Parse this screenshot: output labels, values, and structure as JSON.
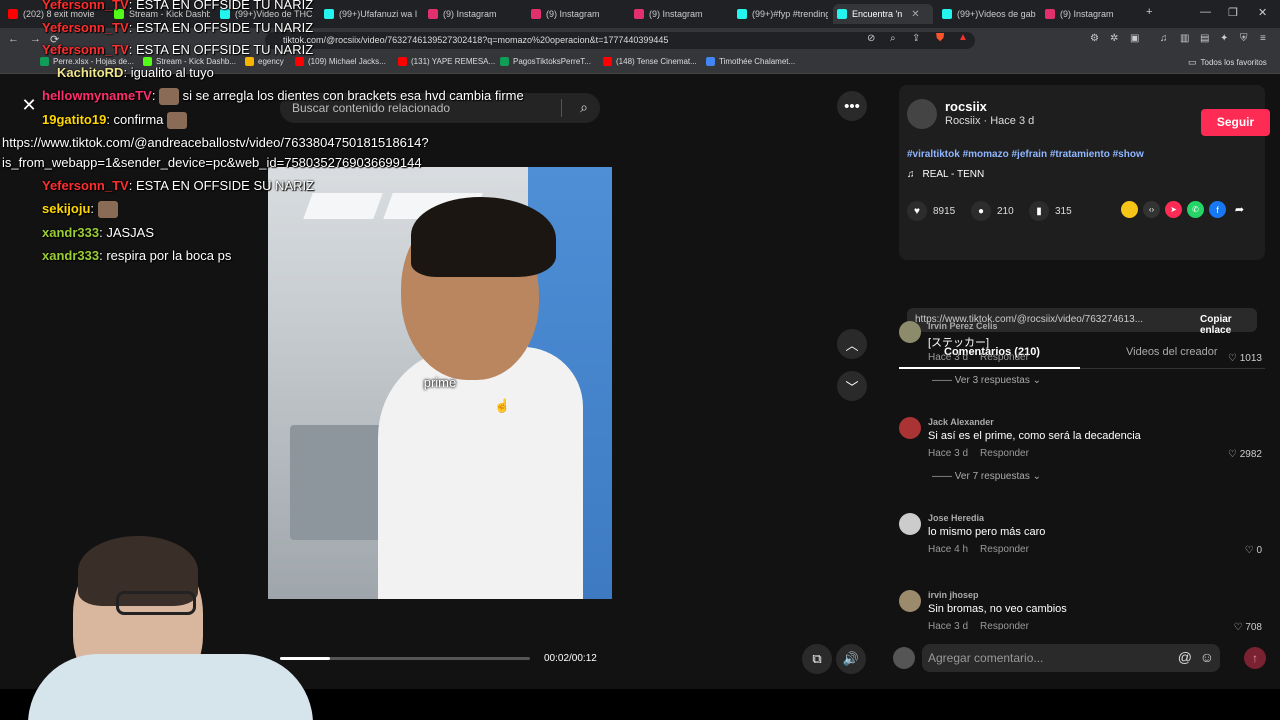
{
  "browser": {
    "tabs": [
      {
        "label": "(202) 8 exit movie",
        "color": "#ff0000"
      },
      {
        "label": "Stream - Kick Dashb",
        "color": "#53fc18"
      },
      {
        "label": "(99+)Video de THC",
        "color": "#25f4ee"
      },
      {
        "label": "(99+)Ufafanuzi wa I",
        "color": "#25f4ee"
      },
      {
        "label": "(9) Instagram",
        "color": "#e1306c"
      },
      {
        "label": "(9) Instagram",
        "color": "#e1306c"
      },
      {
        "label": "(9) Instagram",
        "color": "#e1306c"
      },
      {
        "label": "(99+)#fyp #trending",
        "color": "#25f4ee"
      },
      {
        "label": "Encuentra 'n",
        "color": "#25f4ee"
      },
      {
        "label": "(99+)Videos de gab",
        "color": "#25f4ee"
      },
      {
        "label": "(9) Instagram",
        "color": "#e1306c"
      }
    ],
    "url": "tiktok.com/@rocsiix/video/7632746139527302418?q=momazo%20operacion&t=1777440399445",
    "bookmarks": [
      {
        "label": "Perre.xlsx - Hojas de...",
        "color": "#0f9d58"
      },
      {
        "label": "Stream - Kick Dashb...",
        "color": "#53fc18"
      },
      {
        "label": "egency",
        "color": "#f4b400"
      },
      {
        "label": "(109) Michael Jacks...",
        "color": "#ff0000"
      },
      {
        "label": "(131) YAPE REMESA...",
        "color": "#ff0000"
      },
      {
        "label": "PagosTiktoksPerreT...",
        "color": "#0f9d58"
      },
      {
        "label": "(148) Tense Cinemat...",
        "color": "#ff0000"
      },
      {
        "label": "Timothée Chalamet...",
        "color": "#4285f4"
      }
    ],
    "all_bookmarks": "Todos los favoritos"
  },
  "chat": [
    {
      "user": "Yefersonn_TV",
      "color": "#ff2e2e",
      "msg": "ESTA EN OFFSIDE TU NARIZ"
    },
    {
      "user": "Yefersonn_TV",
      "color": "#ff2e2e",
      "msg": "ESTA EN OFFSIDE TU NARIZ"
    },
    {
      "user": "Yefersonn_TV",
      "color": "#ff2e2e",
      "msg": "ESTA EN OFFSIDE TU NARIZ"
    },
    {
      "user": "KachitoRD",
      "color": "#f0e68c",
      "msg": "igualito al tuyo"
    },
    {
      "user": "hellowmynameTV",
      "color": "#ff2e6e",
      "msg": "si se arregla los dientes con brackets esa hvd cambia firme"
    },
    {
      "user": "19gatito19",
      "color": "#ffd700",
      "msg": "confirma"
    },
    {
      "link1": "https://www.tiktok.com/@andreaceballostv/video/7633804750181518614?",
      "link2": "is_from_webapp=1&sender_device=pc&web_id=7580352769036699144"
    },
    {
      "user": "Yefersonn_TV",
      "color": "#ff2e2e",
      "msg": "ESTA EN OFFSIDE SU NARIZ"
    },
    {
      "user": "sekijoju",
      "color": "#ffd700",
      "msg": ""
    },
    {
      "user": "xandr333",
      "color": "#9acd32",
      "msg": "JASJAS"
    },
    {
      "user": "xandr333",
      "color": "#9acd32",
      "msg": "respira por la boca ps"
    }
  ],
  "video": {
    "search_placeholder": "Buscar contenido relacionado",
    "caption": "prime",
    "time": "00:02/00:12",
    "progress": 0.2
  },
  "creator": {
    "handle": "rocsiix",
    "subline": "Rocsiix · Hace 3 d",
    "follow": "Seguir",
    "hashtags": "#viraltiktok #momazo #jefrain #tratamiento #show",
    "music": "REAL - TENN",
    "likes": "8915",
    "comments": "210",
    "saves": "315",
    "link": "https://www.tiktok.com/@rocsiix/video/763274613...",
    "copy_link": "Copiar enlace"
  },
  "tabs": {
    "comments": "Comentarios (210)",
    "creator_videos": "Videos del creador"
  },
  "comments": [
    {
      "name": "Irvin Perez Celis",
      "text": "[ステッカー]",
      "time": "Hace 3 d",
      "reply": "Responder",
      "likes": "1013",
      "replies": "Ver 3 respuestas"
    },
    {
      "name": "Jack Alexander",
      "text": "Si así es el prime, como será la decadencia",
      "time": "Hace 3 d",
      "reply": "Responder",
      "likes": "2982",
      "replies": "Ver 7 respuestas"
    },
    {
      "name": "Jose Heredia",
      "text": "lo mismo pero más caro",
      "time": "Hace 4 h",
      "reply": "Responder",
      "likes": "0",
      "replies": ""
    },
    {
      "name": "irvin jhosep",
      "text": "Sin bromas, no veo cambios",
      "time": "Hace 3 d",
      "reply": "Responder",
      "likes": "708",
      "replies": ""
    }
  ],
  "comment_input": "Agregar comentario..."
}
